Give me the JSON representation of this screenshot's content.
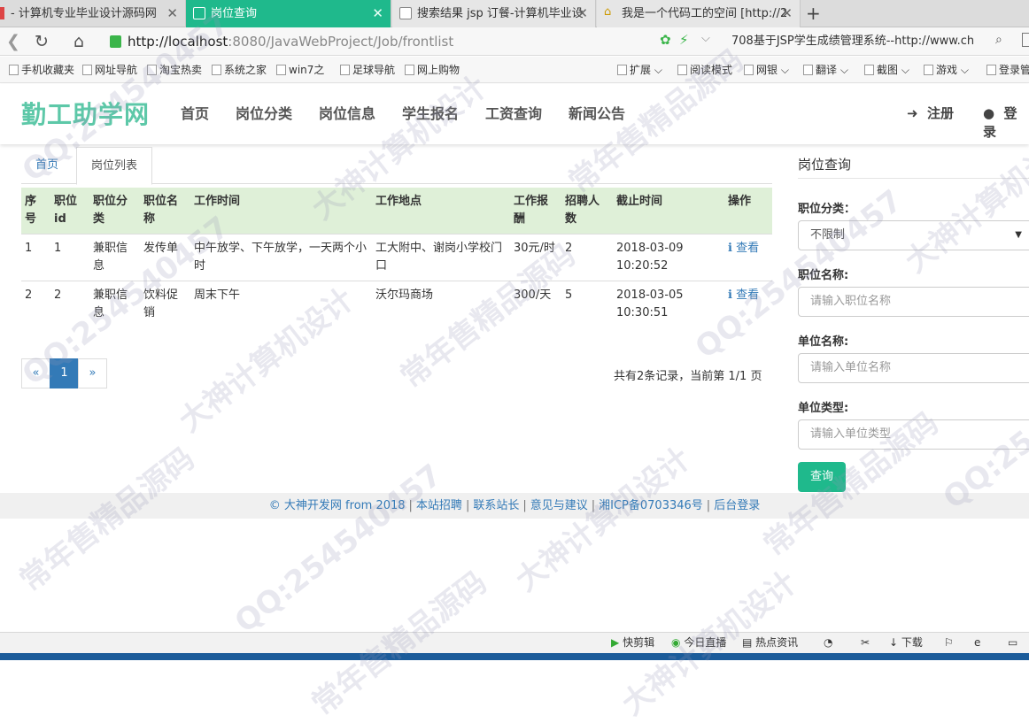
{
  "browser": {
    "tabs": [
      {
        "title": "- 计算机专业毕业设计源码网",
        "active": false
      },
      {
        "title": "岗位查询",
        "active": true
      },
      {
        "title": "搜索结果 jsp 订餐-计算机毕业设",
        "active": false
      },
      {
        "title": "我是一个代码工的空间 [http://2",
        "active": false
      }
    ],
    "new_tab": "+",
    "url_host": "http://localhost",
    "url_path": ":8080/JavaWebProject/Job/frontlist",
    "search_text": "708基于JSP学生成绩管理系统--http://www.ch",
    "bookmarks": [
      "手机收藏夹",
      "网址导航",
      "淘宝热卖",
      "系统之家",
      "win7之",
      "足球导航",
      "网上购物"
    ],
    "bookmarks_right": [
      "扩展",
      "阅读模式",
      "网银",
      "翻译",
      "截图",
      "游戏",
      "登录管"
    ],
    "status_items": [
      "快剪辑",
      "今日直播",
      "热点资讯",
      "下载"
    ]
  },
  "site": {
    "logo": "勤工助学网",
    "nav": [
      "首页",
      "岗位分类",
      "岗位信息",
      "学生报名",
      "工资查询",
      "新闻公告"
    ],
    "register": "注册",
    "login": "登录"
  },
  "content": {
    "tabs": [
      "首页",
      "岗位列表"
    ],
    "columns": [
      "序号",
      "职位id",
      "职位分类",
      "职位名称",
      "工作时间",
      "工作地点",
      "工作报酬",
      "招聘人数",
      "截止时间",
      "操作"
    ],
    "rows": [
      {
        "no": "1",
        "id": "1",
        "category": "兼职信息",
        "name": "发传单",
        "time": "中午放学、下午放学，一天两个小时",
        "place": "工大附中、谢岗小学校门口",
        "pay": "30元/时",
        "count": "2",
        "deadline": "2018-03-09 10:20:52",
        "action": "查看"
      },
      {
        "no": "2",
        "id": "2",
        "category": "兼职信息",
        "name": "饮料促销",
        "time": "周末下午",
        "place": "沃尔玛商场",
        "pay": "300/天",
        "count": "5",
        "deadline": "2018-03-05 10:30:51",
        "action": "查看"
      }
    ],
    "pager": {
      "prev": "«",
      "current": "1",
      "next": "»"
    },
    "total": "共有2条记录，当前第 1/1 页"
  },
  "sidebar": {
    "title": "岗位查询",
    "category_label": "职位分类：",
    "category_value": "不限制",
    "name_label": "职位名称:",
    "name_placeholder": "请输入职位名称",
    "unit_label": "单位名称:",
    "unit_placeholder": "请输入单位名称",
    "type_label": "单位类型:",
    "type_placeholder": "请输入单位类型",
    "query_button": "查询"
  },
  "footer": {
    "links": [
      "© 大神开发网 from 2018",
      "本站招聘",
      "联系站长",
      "意见与建议",
      "湘ICP备0703346号",
      "后台登录"
    ]
  },
  "watermark": {
    "texts": [
      "QQ:254540457",
      "大神计算机设计",
      "常年售精品源码"
    ],
    "color": "#9696b4"
  },
  "colors": {
    "accent": "#1fb98c",
    "link": "#337ab7",
    "table_header": "#dff0d8"
  }
}
